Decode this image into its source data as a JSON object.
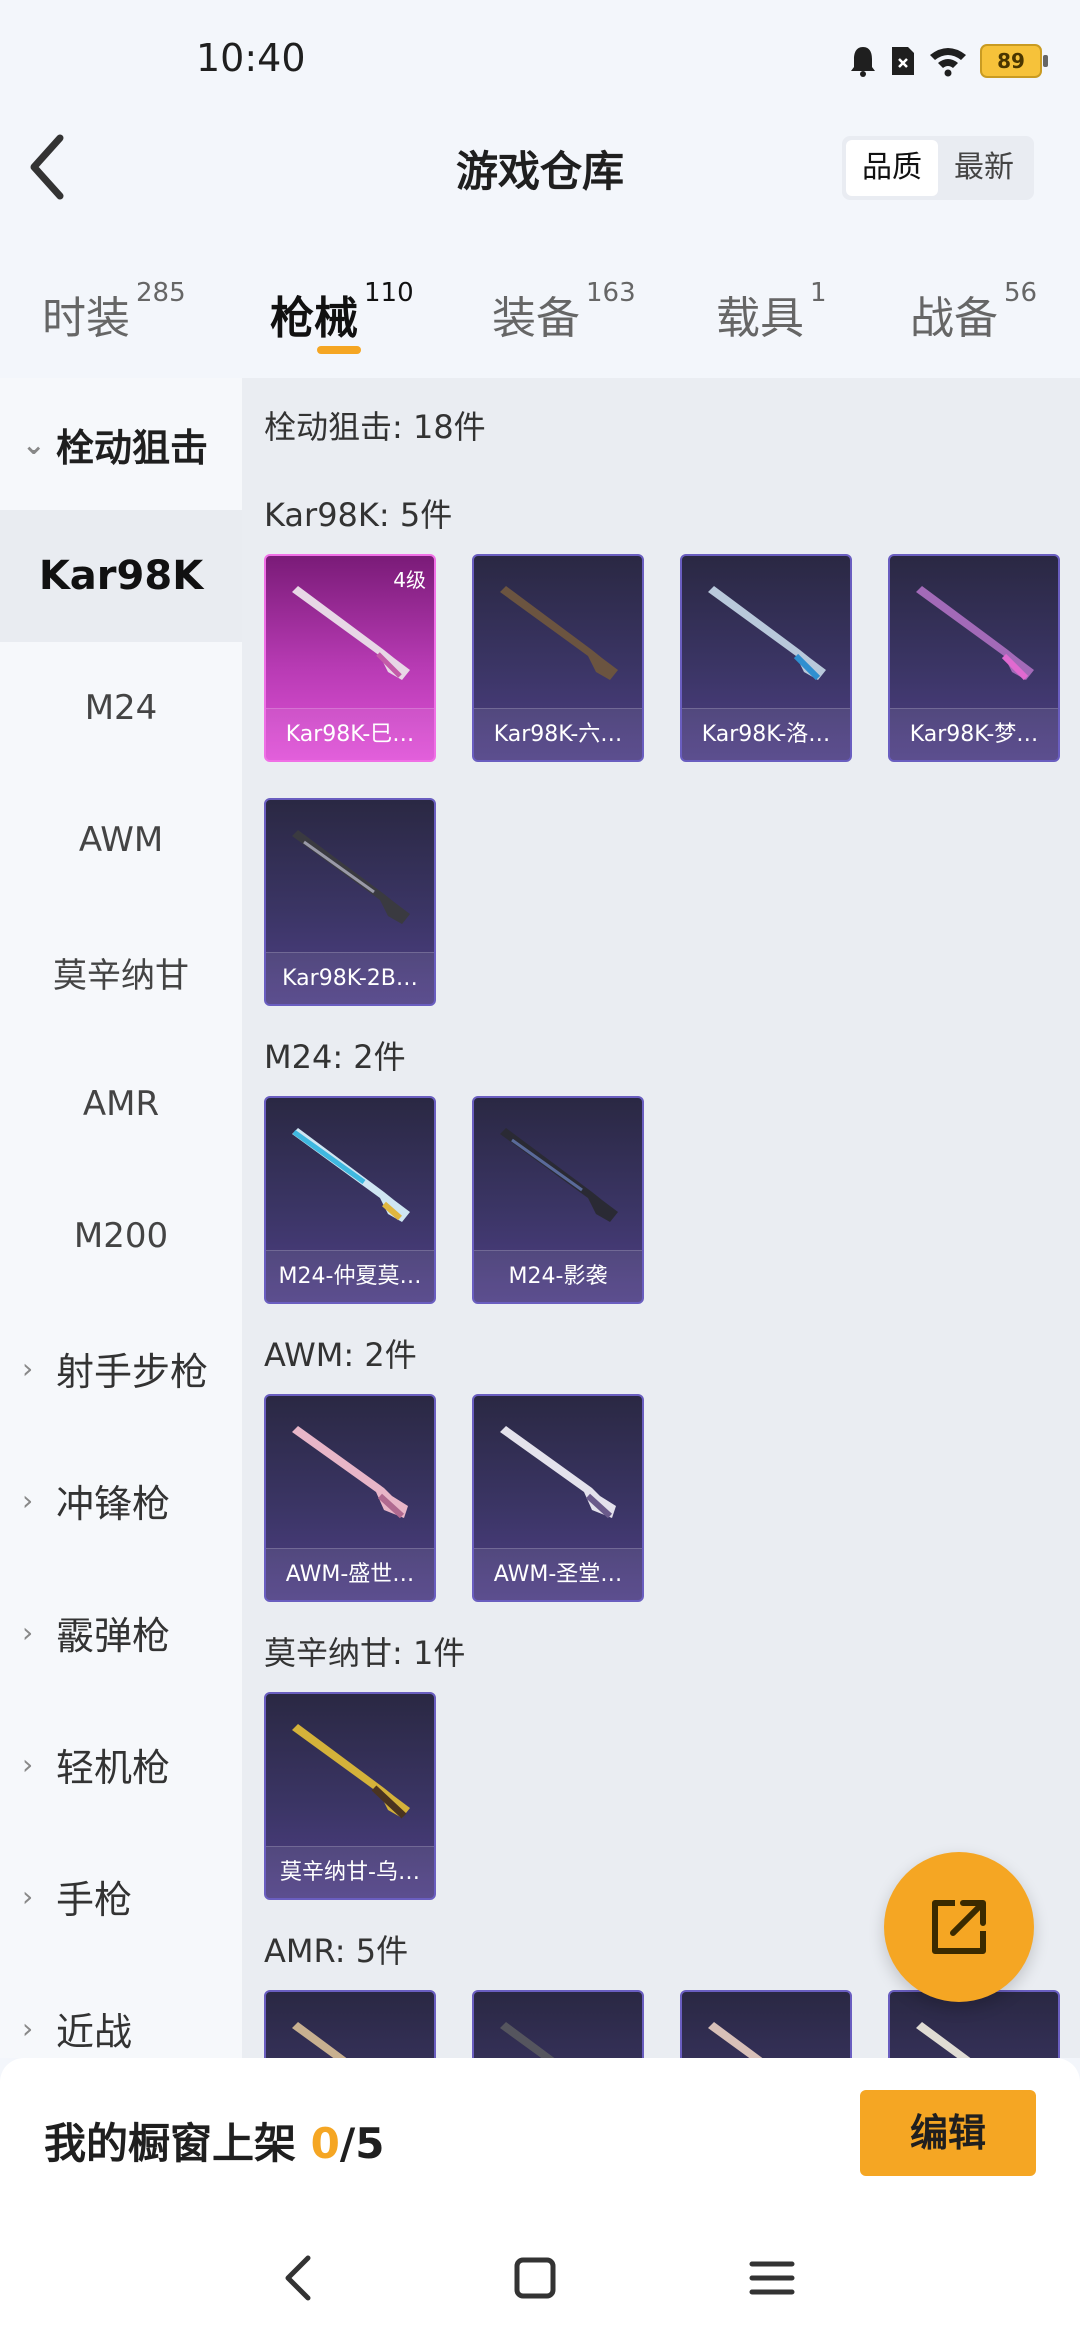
{
  "status": {
    "time": "10:40",
    "battery": "89"
  },
  "header": {
    "title": "游戏仓库",
    "sort_options": [
      "品质",
      "最新"
    ],
    "sort_selected": "品质"
  },
  "tabs": [
    {
      "label": "时装",
      "count": "285"
    },
    {
      "label": "枪械",
      "count": "110",
      "active": true
    },
    {
      "label": "装备",
      "count": "163"
    },
    {
      "label": "载具",
      "count": "1"
    },
    {
      "label": "战备",
      "count": "56"
    }
  ],
  "sidebar": {
    "groups": [
      {
        "label": "栓动狙击",
        "expanded": true
      },
      {
        "label": "射手步枪"
      },
      {
        "label": "冲锋枪"
      },
      {
        "label": "霰弹枪"
      },
      {
        "label": "轻机枪"
      },
      {
        "label": "手枪"
      },
      {
        "label": "近战"
      }
    ],
    "subitems": [
      "Kar98K",
      "M24",
      "AWM",
      "莫辛纳甘",
      "AMR",
      "M200"
    ],
    "active_subitem": "Kar98K"
  },
  "main": {
    "category_total": "栓动狙击: 18件",
    "sections": [
      {
        "title": "Kar98K: 5件",
        "items": [
          {
            "name": "Kar98K-巳…",
            "badge": "4级",
            "rarity": "legendary"
          },
          {
            "name": "Kar98K-六…"
          },
          {
            "name": "Kar98K-洛…"
          },
          {
            "name": "Kar98K-梦…"
          },
          {
            "name": "Kar98K-2B…"
          }
        ]
      },
      {
        "title": "M24: 2件",
        "items": [
          {
            "name": "M24-仲夏莫…"
          },
          {
            "name": "M24-影袭"
          }
        ]
      },
      {
        "title": "AWM: 2件",
        "items": [
          {
            "name": "AWM-盛世…"
          },
          {
            "name": "AWM-圣堂…"
          }
        ]
      },
      {
        "title": "莫辛纳甘: 1件",
        "items": [
          {
            "name": "莫辛纳甘-乌…"
          }
        ]
      },
      {
        "title": "AMR: 5件",
        "items": []
      }
    ]
  },
  "bottom": {
    "shelf_label": "我的橱窗上架 ",
    "shelf_current": "0",
    "shelf_total": "/5",
    "edit_label": "编辑"
  },
  "colors": {
    "accent": "#f5a623",
    "card_purple": "#3b3565",
    "card_legendary": "#b83bb4"
  },
  "icons": [
    "back-icon",
    "share-icon",
    "nav-back-icon",
    "nav-home-icon",
    "nav-menu-icon",
    "chevron-down-icon",
    "chevron-right-icon"
  ]
}
